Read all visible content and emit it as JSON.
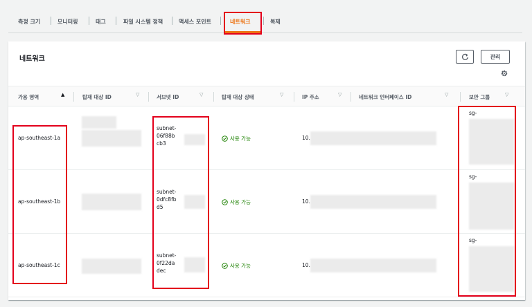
{
  "tabs": [
    {
      "label": "측정 크기"
    },
    {
      "label": "모니터링"
    },
    {
      "label": "태그"
    },
    {
      "label": "파일 시스템 정책"
    },
    {
      "label": "액세스 포인트"
    },
    {
      "label": "네트워크",
      "active": true
    },
    {
      "label": "복제"
    }
  ],
  "panel": {
    "title": "네트워크",
    "manage_label": "관리"
  },
  "table": {
    "columns": [
      {
        "label": "가용 영역",
        "sorted": true
      },
      {
        "label": "탑재 대상 ID"
      },
      {
        "label": "서브넷 ID"
      },
      {
        "label": "탑재 대상 상태"
      },
      {
        "label": "IP 주소"
      },
      {
        "label": "네트워크 인터페이스 ID"
      },
      {
        "label": "보안 그룹"
      }
    ],
    "rows": [
      {
        "az": "ap-southeast-1a",
        "subnet_l1": "subnet-",
        "subnet_l2": "06f88b",
        "subnet_l3": "cb3",
        "status": "사용 가능",
        "ip": "10.",
        "sg": "sg-"
      },
      {
        "az": "ap-southeast-1b",
        "subnet_l1": "subnet-",
        "subnet_l2": "0dfc8fb",
        "subnet_l3": "d5",
        "status": "사용 가능",
        "ip": "10.",
        "sg": "sg-"
      },
      {
        "az": "ap-southeast-1c",
        "subnet_l1": "subnet-",
        "subnet_l2": "0f22da",
        "subnet_l3": "dec",
        "status": "사용 가능",
        "ip": "10.",
        "sg": "sg-"
      }
    ]
  },
  "colors": {
    "active_tab": "#ec7211",
    "available": "#1d8102",
    "highlight": "#e3001b"
  }
}
